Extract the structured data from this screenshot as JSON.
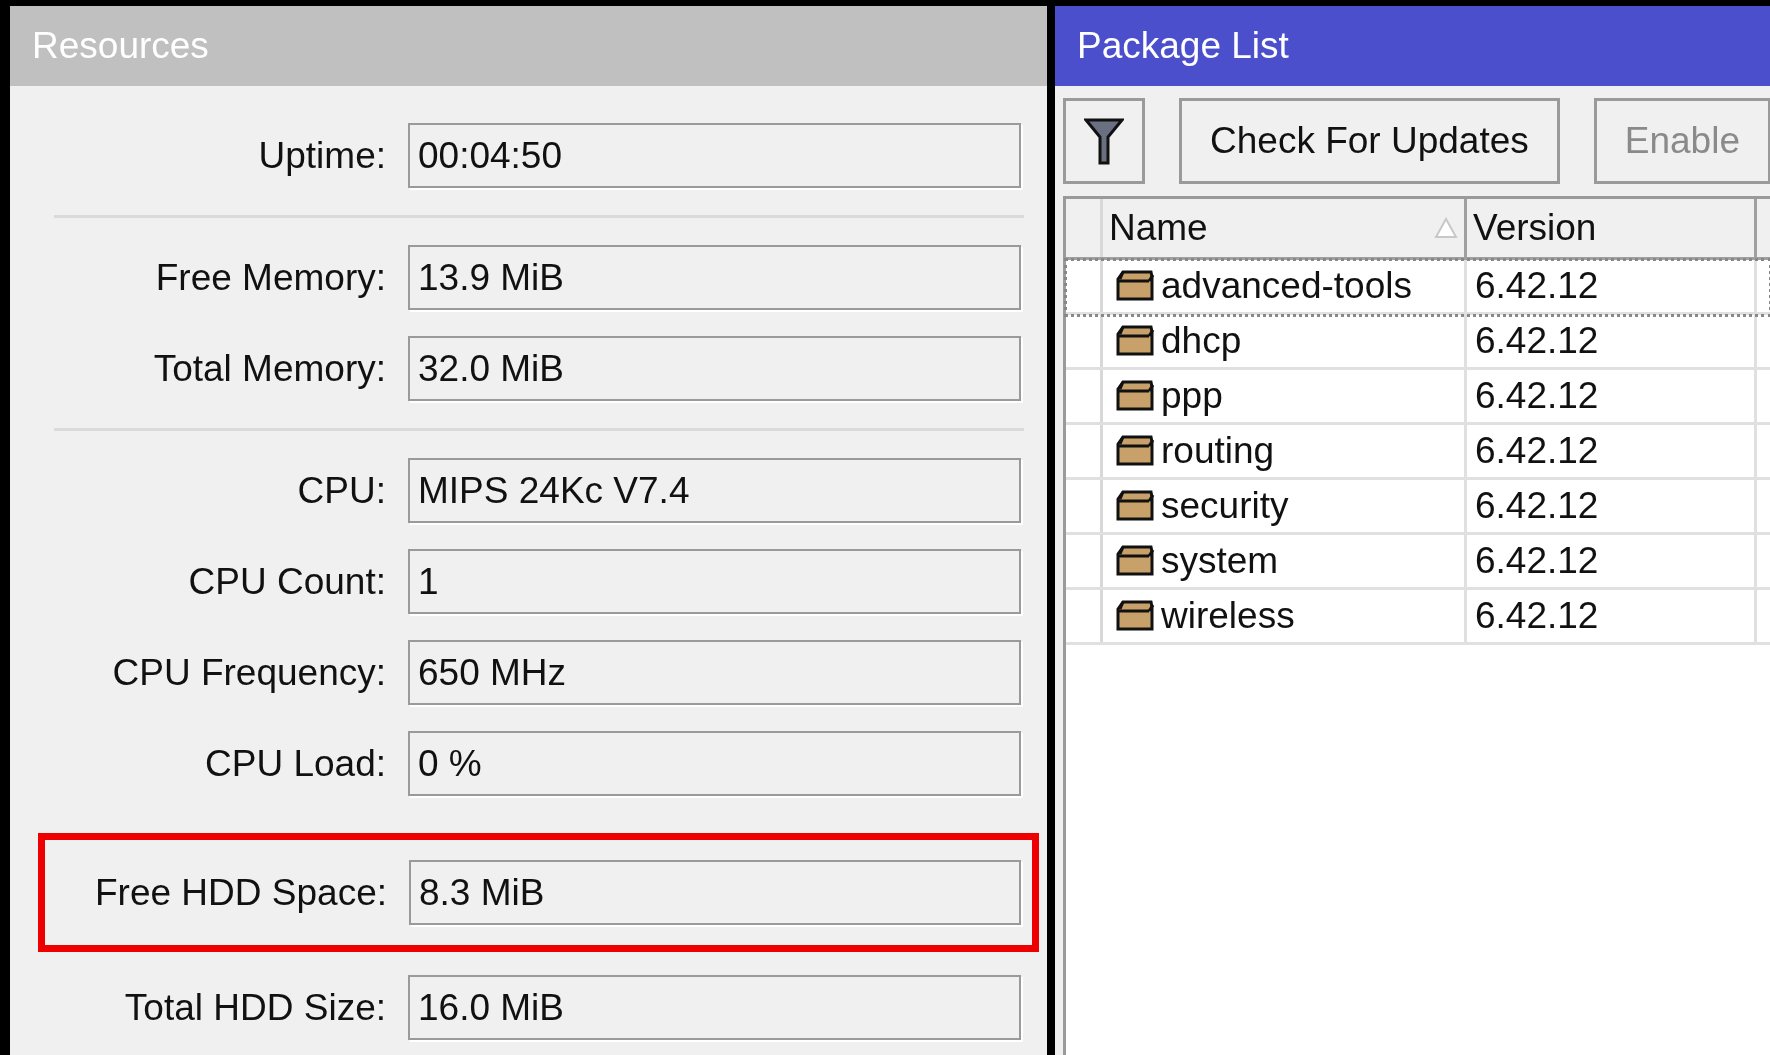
{
  "resources": {
    "title": "Resources",
    "groups": [
      [
        {
          "label": "Uptime:",
          "value": "00:04:50",
          "highlighted": false
        }
      ],
      [
        {
          "label": "Free Memory:",
          "value": "13.9 MiB",
          "highlighted": false
        },
        {
          "label": "Total Memory:",
          "value": "32.0 MiB",
          "highlighted": false
        }
      ],
      [
        {
          "label": "CPU:",
          "value": "MIPS 24Kc V7.4",
          "highlighted": false
        },
        {
          "label": "CPU Count:",
          "value": "1",
          "highlighted": false
        },
        {
          "label": "CPU Frequency:",
          "value": "650 MHz",
          "highlighted": false
        },
        {
          "label": "CPU Load:",
          "value": "0 %",
          "highlighted": false
        },
        {
          "label": "Free HDD Space:",
          "value": "8.3 MiB",
          "highlighted": true
        },
        {
          "label": "Total HDD Size:",
          "value": "16.0 MiB",
          "highlighted": false
        }
      ]
    ]
  },
  "package_list": {
    "title": "Package List",
    "toolbar": [
      {
        "kind": "filter"
      },
      {
        "kind": "text",
        "label": "Check For Updates"
      },
      {
        "kind": "text",
        "label": "Enable"
      }
    ],
    "columns": [
      {
        "label": "Name",
        "sorted": true
      },
      {
        "label": "Version",
        "sorted": false
      }
    ],
    "rows": [
      {
        "name": "advanced-tools",
        "version": "6.42.12",
        "focused": true
      },
      {
        "name": "dhcp",
        "version": "6.42.12",
        "focused": false
      },
      {
        "name": "ppp",
        "version": "6.42.12",
        "focused": false
      },
      {
        "name": "routing",
        "version": "6.42.12",
        "focused": false
      },
      {
        "name": "security",
        "version": "6.42.12",
        "focused": false
      },
      {
        "name": "system",
        "version": "6.42.12",
        "focused": false
      },
      {
        "name": "wireless",
        "version": "6.42.12",
        "focused": false
      }
    ]
  }
}
